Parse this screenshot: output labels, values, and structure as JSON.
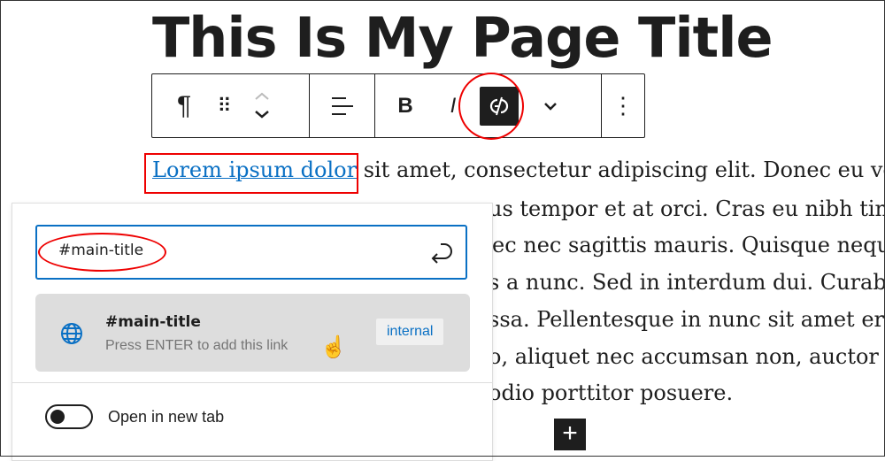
{
  "page_title": "This Is My Page Title",
  "toolbar": {
    "paragraph": "¶",
    "bold": "B",
    "italic": "I",
    "more": "⋮"
  },
  "paragraph": {
    "link_text": "Lorem ipsum dolor",
    "lines": [
      " sit amet, consectetur adipiscing elit. Donec eu vehi",
      "us tempor et at orci. Cras eu nibh tincid",
      "ec nec sagittis mauris. Quisque neque",
      "s a nunc. Sed in interdum dui. Curabitu",
      "ssa. Pellentesque in nunc sit amet erat",
      "o, aliquet nec accumsan non, auctor lo",
      "odio porttitor posuere."
    ]
  },
  "link_popover": {
    "input_value": "#main-title",
    "suggestion": {
      "title": "#main-title",
      "hint": "Press ENTER to add this link",
      "badge": "internal"
    },
    "toggle_label": "Open in new tab",
    "toggle_on": false
  },
  "add_block": "+"
}
